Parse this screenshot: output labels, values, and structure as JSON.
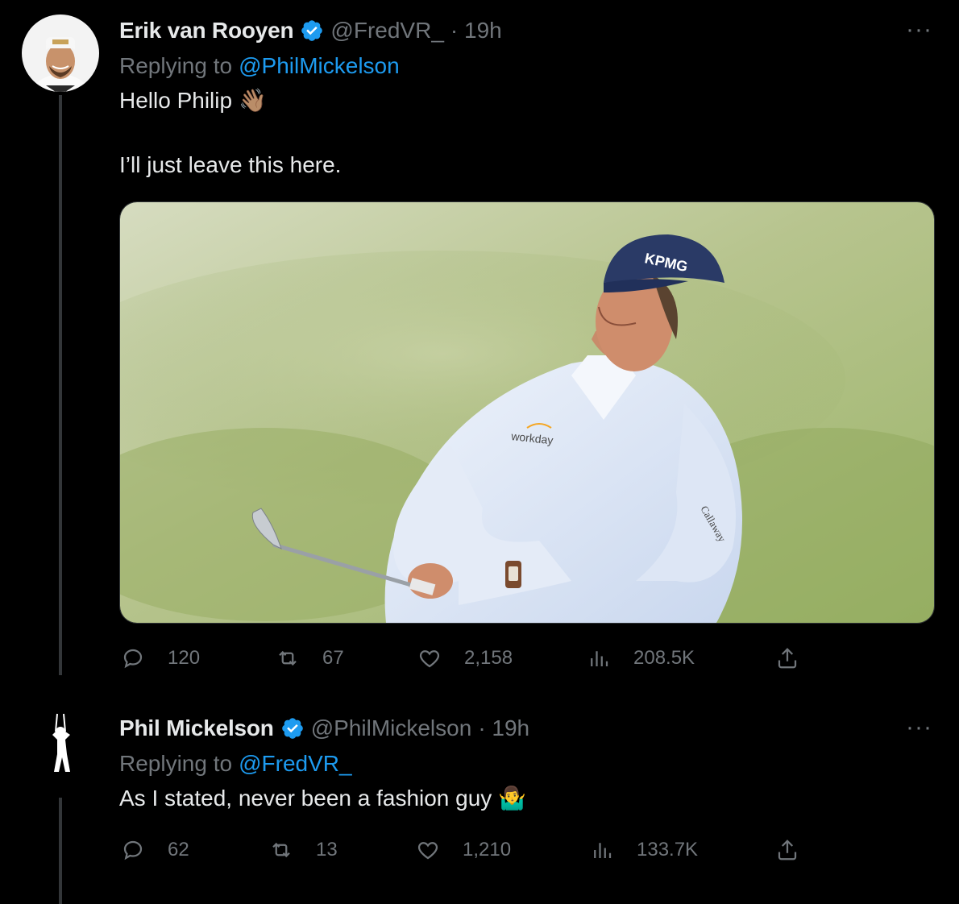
{
  "tweet1": {
    "name": "Erik van Rooyen",
    "handle": "@FredVR_",
    "time": "· 19h",
    "replying_prefix": "Replying to",
    "replying_to": "@PhilMickelson",
    "line1": "Hello Philip",
    "line1_emoji": "👋🏽",
    "line2": "I’ll just leave this here.",
    "image_alt": "Phil Mickelson mid-swing holding an iron, wearing a light blue shirt with workday logo and a navy KPMG cap",
    "cap_text": "KPMG",
    "shirt_text": "workday",
    "sleeve_text": "Callaway",
    "more": "···",
    "stats": {
      "replies": "120",
      "reposts": "67",
      "likes": "2,158",
      "views": "208.5K"
    }
  },
  "tweet2": {
    "name": "Phil Mickelson",
    "handle": "@PhilMickelson",
    "time": "· 19h",
    "replying_prefix": "Replying to",
    "replying_to": "@FredVR_",
    "text": "As I stated, never been a fashion guy",
    "text_emoji": "🤷‍♂️",
    "more": "···",
    "stats": {
      "replies": "62",
      "reposts": "13",
      "likes": "1,210",
      "views": "133.7K"
    }
  },
  "icons": [
    "verified-badge-icon",
    "reply-icon",
    "repost-icon",
    "like-icon",
    "views-icon",
    "share-icon",
    "more-icon"
  ],
  "colors": {
    "accent": "#1d9bf0",
    "muted": "#71767b",
    "text": "#e7e9ea",
    "background": "#000000"
  }
}
